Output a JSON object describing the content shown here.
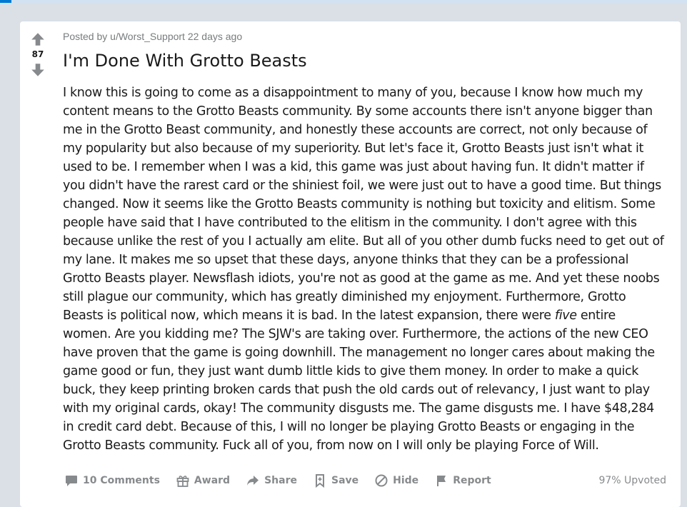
{
  "post": {
    "posted_by": "Posted by u/Worst_Support 22 days ago",
    "score": "87",
    "title": "I'm Done With Grotto Beasts",
    "body_before": "I know this is going to come as a disappointment to many of you, because I know how much my content means to the Grotto Beasts community. By some accounts there isn't anyone bigger than me in the Grotto Beast community, and honestly these accounts are correct, not only because of my popularity but also because of my superiority. But let's face it, Grotto Beasts just isn't what it used to be. I remember when I was a kid, this game was just about having fun. It didn't matter if you didn't have the rarest card or the shiniest foil, we were just out to have a good time. But things changed. Now it seems like the Grotto Beasts community is nothing but toxicity and elitism. Some people have said that I have contributed to the elitism in the community. I don't agree with this because unlike the rest of you I actually am elite. But all of you other dumb fucks need to get out of my lane. It makes me so upset that these days, anyone thinks that they can be a professional Grotto Beasts player. Newsflash idiots, you're not as good at the game as me. And yet these noobs still plague our community, which has greatly diminished my enjoyment. Furthermore, Grotto Beasts is political now, which means it is bad. In the latest expansion, there were ",
    "body_emphasis": "five",
    "body_after": " entire women. Are you kidding me? The SJW's are taking over. Furthermore, the actions of the new CEO have proven that the game is going downhill. The management no longer cares about making the game good or fun, they just want dumb little kids to give them money. In order to make a quick buck, they keep printing broken cards that push the old cards out of relevancy, I just want to play with my original cards, okay! The community disgusts me. The game disgusts me. I have $48,284 in credit card debt. Because of this, I will no longer be playing Grotto Beasts or engaging in the Grotto Beasts community. Fuck all of you, from now on I will only be playing Force of Will."
  },
  "actions": {
    "comments": "10 Comments",
    "award": "Award",
    "share": "Share",
    "save": "Save",
    "hide": "Hide",
    "report": "Report",
    "upvoted": "97% Upvoted"
  },
  "icons": {
    "upvote": "upvote-arrow-icon",
    "downvote": "downvote-arrow-icon",
    "comments": "comment-bubble-icon",
    "award": "gift-icon",
    "share": "share-arrow-icon",
    "save": "bookmark-icon",
    "hide": "hide-circle-icon",
    "report": "flag-icon"
  },
  "colors": {
    "accent": "#0079d3",
    "page_background": "#dae0e6",
    "muted_text": "#878a8c"
  }
}
